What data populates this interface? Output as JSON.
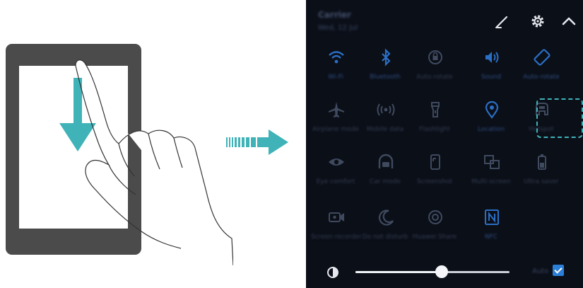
{
  "panel": {
    "carrier": "Carrier",
    "datetime": "Wed, 12 Jul",
    "tiles": [
      {
        "label": "Wi-Fi",
        "icon": "wifi-icon",
        "on": true
      },
      {
        "label": "Bluetooth",
        "icon": "bluetooth-icon",
        "on": true
      },
      {
        "label": "Auto-rotate",
        "icon": "rotate-lock-icon",
        "on": false
      },
      {
        "label": "Sound",
        "icon": "sound-icon",
        "on": true
      },
      {
        "label": "Auto-rotate",
        "icon": "rotate-icon",
        "on": true
      },
      {
        "label": "Airplane mode",
        "icon": "airplane-icon",
        "on": false
      },
      {
        "label": "Mobile data",
        "icon": "mobile-data-icon",
        "on": false
      },
      {
        "label": "Flashlight",
        "icon": "flashlight-icon",
        "on": false
      },
      {
        "label": "Location",
        "icon": "location-icon",
        "on": true
      },
      {
        "label": "Hotspot",
        "icon": "hotspot-icon",
        "on": false
      },
      {
        "label": "Eye comfort",
        "icon": "eye-comfort-icon",
        "on": false
      },
      {
        "label": "Car mode",
        "icon": "car-mode-icon",
        "on": false
      },
      {
        "label": "Screenshot",
        "icon": "screenshot-icon",
        "on": false
      },
      {
        "label": "Multi-screen",
        "icon": "multi-screen-icon",
        "on": false
      },
      {
        "label": "Ultra saver",
        "icon": "battery-saver-icon",
        "on": false
      },
      {
        "label": "Screen recorder",
        "icon": "screen-recorder-icon",
        "on": false
      },
      {
        "label": "Do not disturb",
        "icon": "moon-icon",
        "on": false
      },
      {
        "label": "Huawei Share",
        "icon": "share-icon",
        "on": false
      },
      {
        "label": "NFC",
        "icon": "nfc-icon",
        "on": true
      }
    ],
    "brightness": {
      "level": 0.56,
      "auto_label": "Auto",
      "auto_checked": true
    }
  },
  "colors": {
    "accent_on": "#2b6fc4",
    "off": "#3f4a5f",
    "highlight": "#3fb3b8",
    "arrow": "#3fb3b8",
    "phone": "#4b4b4b"
  }
}
